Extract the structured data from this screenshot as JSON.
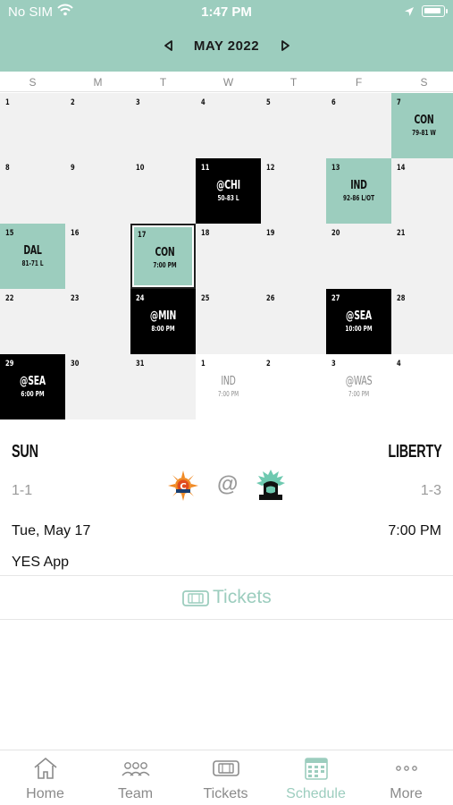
{
  "status_bar": {
    "carrier": "No SIM",
    "time": "1:47 PM"
  },
  "month_nav": {
    "title": "MAY 2022"
  },
  "weekdays": [
    "S",
    "M",
    "T",
    "W",
    "T",
    "F",
    "S"
  ],
  "calendar": {
    "weeks": [
      [
        {
          "day": "1"
        },
        {
          "day": "2"
        },
        {
          "day": "3"
        },
        {
          "day": "4"
        },
        {
          "day": "5"
        },
        {
          "day": "6"
        },
        {
          "day": "7",
          "opponent": "CON",
          "result": "79-81 W",
          "style": "win"
        }
      ],
      [
        {
          "day": "8"
        },
        {
          "day": "9"
        },
        {
          "day": "10"
        },
        {
          "day": "11",
          "opponent": "@CHI",
          "result": "50-83 L",
          "style": "away"
        },
        {
          "day": "12"
        },
        {
          "day": "13",
          "opponent": "IND",
          "result": "92-86 L/OT",
          "style": "win"
        },
        {
          "day": "14"
        }
      ],
      [
        {
          "day": "15",
          "opponent": "DAL",
          "result": "81-71 L",
          "style": "win"
        },
        {
          "day": "16"
        },
        {
          "day": "17",
          "opponent": "CON",
          "result": "7:00 PM",
          "style": "today"
        },
        {
          "day": "18"
        },
        {
          "day": "19"
        },
        {
          "day": "20"
        },
        {
          "day": "21"
        }
      ],
      [
        {
          "day": "22"
        },
        {
          "day": "23"
        },
        {
          "day": "24",
          "opponent": "@MIN",
          "result": "8:00 PM",
          "style": "away"
        },
        {
          "day": "25"
        },
        {
          "day": "26"
        },
        {
          "day": "27",
          "opponent": "@SEA",
          "result": "10:00 PM",
          "style": "away"
        },
        {
          "day": "28"
        }
      ],
      [
        {
          "day": "29",
          "opponent": "@SEA",
          "result": "6:00 PM",
          "style": "away"
        },
        {
          "day": "30"
        },
        {
          "day": "31"
        },
        {
          "day": "1",
          "opponent": "IND",
          "result": "7:00 PM",
          "style": "outside"
        },
        {
          "day": "2",
          "style": "outside"
        },
        {
          "day": "3",
          "opponent": "@WAS",
          "result": "7:00 PM",
          "style": "outside"
        },
        {
          "day": "4",
          "style": "outside"
        }
      ]
    ]
  },
  "game": {
    "home_team": "SUN",
    "away_team": "LIBERTY",
    "home_record": "1-1",
    "away_record": "1-3",
    "at_symbol": "@",
    "date": "Tue, May 17",
    "time": "7:00 PM",
    "broadcast": "YES App",
    "home_logo_icon": "connecticut-sun-logo-icon",
    "away_logo_icon": "new-york-liberty-logo-icon"
  },
  "tickets": {
    "label": "Tickets",
    "icon": "ticket-icon"
  },
  "tabbar": {
    "items": [
      {
        "label": "Home",
        "icon": "home-icon"
      },
      {
        "label": "Team",
        "icon": "team-icon"
      },
      {
        "label": "Tickets",
        "icon": "ticket-icon"
      },
      {
        "label": "Schedule",
        "icon": "calendar-icon",
        "active": true
      },
      {
        "label": "More",
        "icon": "more-icon"
      }
    ]
  },
  "colors": {
    "accent": "#9ccdbe",
    "away_game": "#000000",
    "cell_bg": "#f1f1f1",
    "muted_text": "#9a9a9a"
  }
}
